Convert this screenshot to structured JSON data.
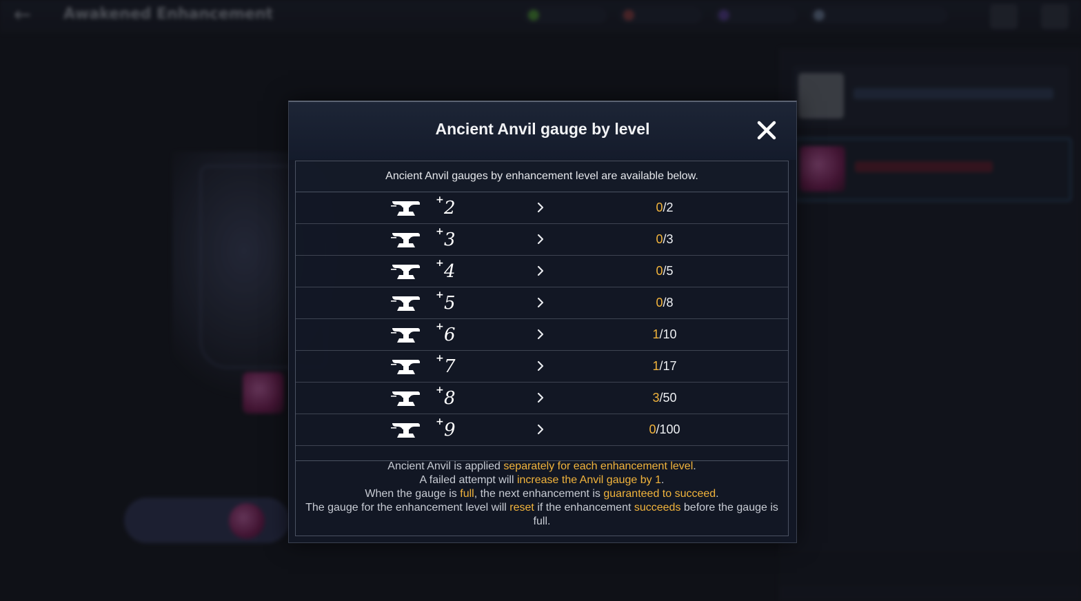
{
  "background": {
    "title": "Awakened Enhancement"
  },
  "modal": {
    "title": "Ancient Anvil gauge by level",
    "close_icon": "close-icon",
    "intro": "Ancient Anvil gauges by enhancement level are available below.",
    "accent_color": "#f2b43c",
    "rows": [
      {
        "icon": "anvil-icon",
        "plus": "+",
        "level": "2",
        "current": "0",
        "separator": "/",
        "max": "2"
      },
      {
        "icon": "anvil-icon",
        "plus": "+",
        "level": "3",
        "current": "0",
        "separator": "/",
        "max": "3"
      },
      {
        "icon": "anvil-icon",
        "plus": "+",
        "level": "4",
        "current": "0",
        "separator": "/",
        "max": "5"
      },
      {
        "icon": "anvil-icon",
        "plus": "+",
        "level": "5",
        "current": "0",
        "separator": "/",
        "max": "8"
      },
      {
        "icon": "anvil-icon",
        "plus": "+",
        "level": "6",
        "current": "1",
        "separator": "/",
        "max": "10"
      },
      {
        "icon": "anvil-icon",
        "plus": "+",
        "level": "7",
        "current": "1",
        "separator": "/",
        "max": "17"
      },
      {
        "icon": "anvil-icon",
        "plus": "+",
        "level": "8",
        "current": "3",
        "separator": "/",
        "max": "50"
      },
      {
        "icon": "anvil-icon",
        "plus": "+",
        "level": "9",
        "current": "0",
        "separator": "/",
        "max": "100"
      }
    ],
    "notes": {
      "line1": {
        "a": "Ancient Anvil is applied ",
        "b": "separately for each enhancement level",
        "c": "."
      },
      "line2": {
        "a": "A failed attempt will ",
        "b": "increase the Anvil gauge by 1",
        "c": "."
      },
      "line3": {
        "a": "When the gauge is ",
        "b": "full",
        "c": ", the next enhancement is ",
        "d": "guaranteed to succeed",
        "e": "."
      },
      "line4": {
        "a": "The gauge for the enhancement level will ",
        "b": "reset",
        "c": " if the enhancement ",
        "d": "succeeds",
        "e": " before the gauge is full."
      }
    }
  }
}
